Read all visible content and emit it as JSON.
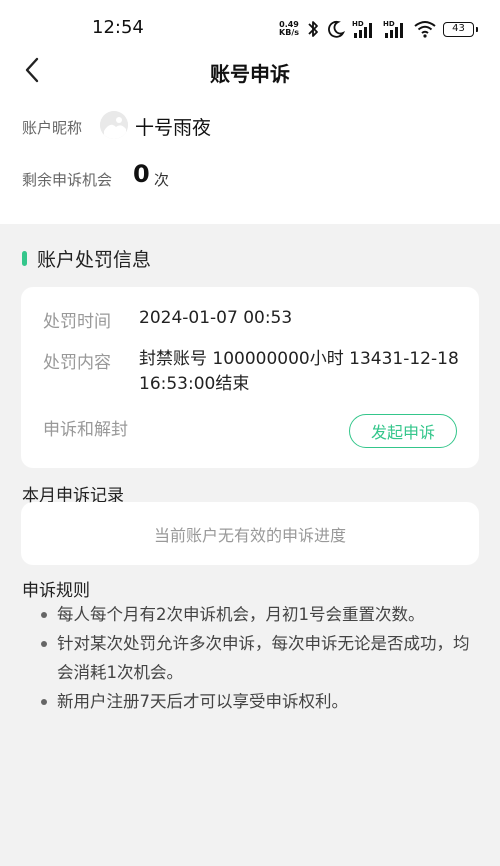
{
  "status_bar": {
    "time": "12:54",
    "net_speed_value": "0.49",
    "net_speed_unit": "KB/s",
    "battery": "43",
    "icons": [
      "bluetooth-icon",
      "moon-icon",
      "signal-hd-icon",
      "signal-hd-icon",
      "wifi-icon",
      "battery-icon"
    ]
  },
  "header": {
    "title": "账号申诉",
    "back_icon": "back-arrow-icon"
  },
  "account": {
    "nickname_label": "账户昵称",
    "nickname": "十号雨夜",
    "chances_label": "剩余申诉机会",
    "chances_count": "0",
    "chances_unit": "次"
  },
  "penalty": {
    "section_title": "账户处罚信息",
    "time_label": "处罚时间",
    "time_value": "2024-01-07 00:53",
    "content_label": "处罚内容",
    "content_value": "封禁账号 100000000小时 13431-12-18 16:53:00结束",
    "unblock_label": "申诉和解封",
    "appeal_button": "发起申诉"
  },
  "records": {
    "title": "本月申诉记录",
    "empty_text": "当前账户无有效的申诉进度"
  },
  "rules": {
    "title": "申诉规则",
    "items": [
      "每人每个月有2次申诉机会，月初1号会重置次数。",
      "针对某次处罚允许多次申诉，每次申诉无论是否成功，均会消耗1次机会。",
      "新用户注册7天后才可以享受申诉权利。"
    ]
  },
  "colors": {
    "accent": "#34c68b",
    "page_bg": "#f2f2f2",
    "card_bg": "#ffffff"
  }
}
